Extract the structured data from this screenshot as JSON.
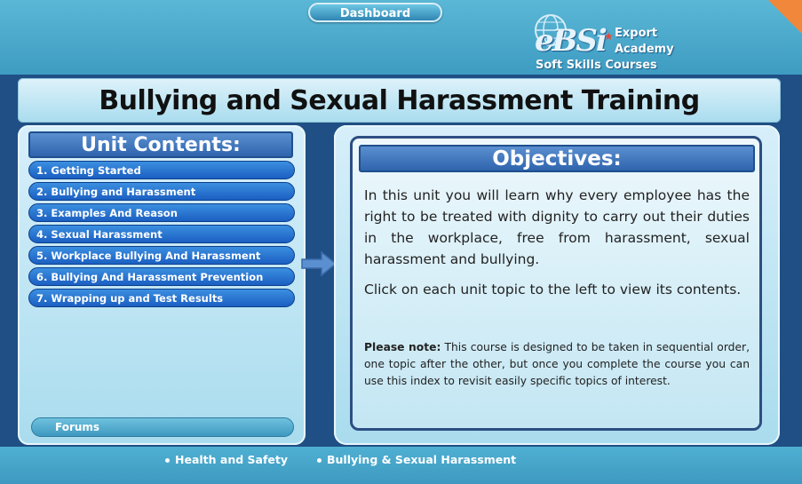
{
  "header": {
    "dashboard_label": "Dashboard",
    "logo_ebsi": "eBSi",
    "logo_line1": "Export",
    "logo_line2": "Academy",
    "logo_sub": "Soft Skills Courses"
  },
  "page_title": "Bullying and Sexual Harassment Training",
  "unit_contents": {
    "heading": "Unit Contents:",
    "items": [
      {
        "label": "1. Getting Started"
      },
      {
        "label": "2. Bullying and Harassment"
      },
      {
        "label": "3. Examples And Reason"
      },
      {
        "label": "4. Sexual Harassment"
      },
      {
        "label": "5. Workplace Bullying And Harassment"
      },
      {
        "label": "6. Bullying And Harassment Prevention"
      },
      {
        "label": "7. Wrapping up and Test Results"
      }
    ],
    "forums_label": "Forums"
  },
  "objectives": {
    "heading": "Objectives:",
    "para1": "In this unit you will learn why every employee has the right to be treated with dignity to carry out their duties in the workplace, free from harassment, sexual harassment and bullying.",
    "para2": "Click on each unit topic to the left to view its contents.",
    "note_label": "Please note:",
    "note_text": " This course is designed to be taken in sequential order, one topic after the other, but once you complete the course you can use this index to revisit easily specific topics of interest."
  },
  "breadcrumbs": [
    {
      "label": "Health and Safety"
    },
    {
      "label": "Bullying & Sexual Harassment"
    }
  ],
  "colors": {
    "accent_blue": "#1b5fc2",
    "header_blue": "#2f64ad",
    "corner_orange": "#f0873a"
  }
}
